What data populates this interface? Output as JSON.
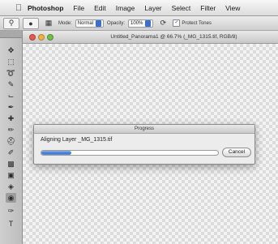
{
  "menubar": {
    "apple_icon": "apple-logo-icon",
    "items": [
      "Photoshop",
      "File",
      "Edit",
      "Image",
      "Layer",
      "Select",
      "Filter",
      "View"
    ]
  },
  "options_bar": {
    "mode_label": "Mode:",
    "mode_value": "Normal",
    "opacity_label": "Opacity:",
    "opacity_value": "100%",
    "protect_tones_label": "Protect Tones"
  },
  "document": {
    "title": "Untitled_Panorama1 @ 66.7% (_MG_1315.tif, RGB/8)"
  },
  "progress_dialog": {
    "title": "Progress",
    "message": "Aligning Layer _MG_1315.tif",
    "progress": 0.17,
    "cancel_label": "Cancel",
    "accent_color": "#3e78d1"
  },
  "tools": [
    "move-tool-icon",
    "marquee-tool-icon",
    "lasso-tool-icon",
    "quick-selection-tool-icon",
    "crop-tool-icon",
    "eyedropper-tool-icon",
    "healing-brush-tool-icon",
    "brush-tool-icon",
    "clone-stamp-tool-icon",
    "history-brush-tool-icon",
    "eraser-tool-icon",
    "gradient-tool-icon",
    "blur-tool-icon",
    "dodge-tool-icon",
    "pen-tool-icon",
    "type-tool-icon"
  ]
}
